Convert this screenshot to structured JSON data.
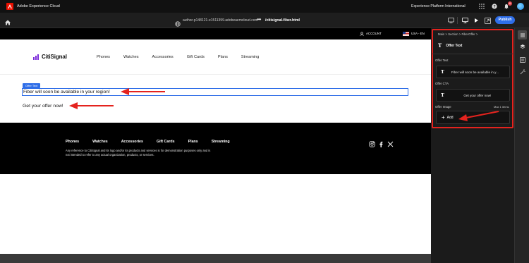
{
  "shell": {
    "app_title": "Adobe Experience Cloud",
    "org_name": "Experience Platform International",
    "notification_count": "6"
  },
  "editor": {
    "url": "author-p148121-e1511399.adobeaemcloud.com",
    "page_path": "/citisignal-fiber.html",
    "publish_label": "Publish"
  },
  "site": {
    "account_label": "ACCOUNT",
    "locale_label": "USA - EN",
    "brand": "CitiSignal",
    "nav": [
      "Phones",
      "Watches",
      "Accessories",
      "Gift Cards",
      "Plans",
      "Streaming"
    ],
    "offer_tag": "Offer Text",
    "offer_text": "Fiber will soon be available in your region!",
    "cta_text": "Get your offer now!",
    "footer_links": [
      "Phones",
      "Watches",
      "Accessories",
      "Gift Cards",
      "Plans",
      "Streaming"
    ],
    "footer_disclaimer": "Any reference to CitiSignal and its logo and/or its products and services is for demonstration purposes only and is not intended to refer to any actual organization, products, or services."
  },
  "panel": {
    "breadcrumbs": "Main  >  Section  >  FiberOffer  >",
    "title": "Offer Text",
    "fields": [
      {
        "label": "Offer Text",
        "value": "Fiber will soon be available in y..."
      },
      {
        "label": "Offer CTA",
        "value": "Get your offer now!"
      }
    ],
    "image_field": {
      "label": "Offer Image",
      "max": "Max 1 items",
      "add_label": "Add"
    }
  },
  "colors": {
    "accent": "#2f6ee8",
    "annotation": "#e4231e",
    "brand": "#7a2ad9"
  }
}
